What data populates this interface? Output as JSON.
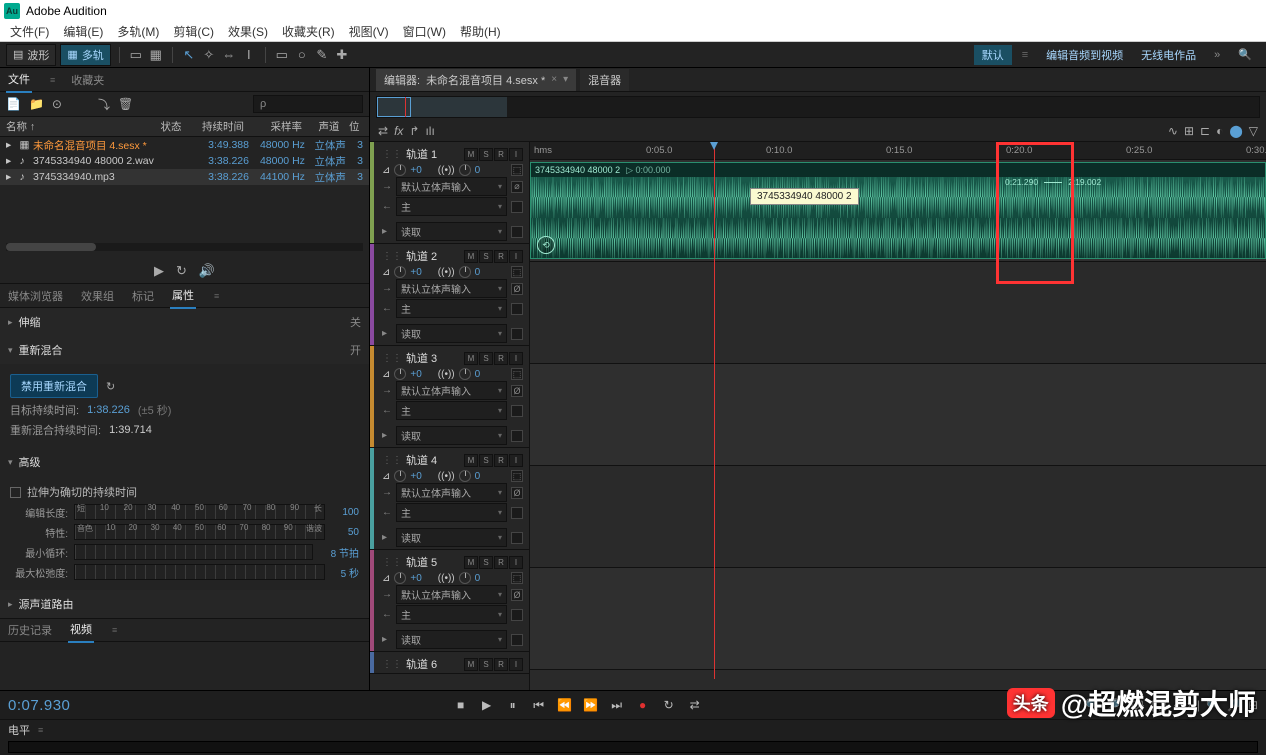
{
  "app": {
    "title": "Adobe Audition"
  },
  "menubar": [
    "文件(F)",
    "编辑(E)",
    "多轨(M)",
    "剪辑(C)",
    "效果(S)",
    "收藏夹(R)",
    "视图(V)",
    "窗口(W)",
    "帮助(H)"
  ],
  "toolbar": {
    "waveform": "波形",
    "multitrack": "多轨"
  },
  "workspaces": [
    "默认",
    "编辑音频到视频",
    "无线电作品"
  ],
  "files_panel": {
    "tabs": [
      "文件",
      "收藏夹"
    ],
    "search_placeholder": "ρ",
    "columns": {
      "name": "名称 ↑",
      "status": "状态",
      "duration": "持续时间",
      "rate": "采样率",
      "channels": "声道",
      "depth": "位"
    },
    "rows": [
      {
        "icon": "▸",
        "type": "sesx",
        "name": "未命名混音项目 4.sesx *",
        "dur": "3:49.388",
        "rate": "48000 Hz",
        "ch": "立体声",
        "d": "3"
      },
      {
        "icon": "▸",
        "type": "wav",
        "name": "3745334940 48000 2.wav",
        "dur": "3:38.226",
        "rate": "48000 Hz",
        "ch": "立体声",
        "d": "3"
      },
      {
        "icon": "▸",
        "type": "mp3",
        "name": "3745334940.mp3",
        "dur": "3:38.226",
        "rate": "44100 Hz",
        "ch": "立体声",
        "d": "3"
      }
    ],
    "transport_icons": [
      "▶",
      "↻",
      "🔊"
    ]
  },
  "props_panel": {
    "tabs": [
      "媒体浏览器",
      "效果组",
      "标记",
      "属性"
    ],
    "section_stretch": "伸缩",
    "close": "关",
    "open": "开",
    "remix_header": "重新混合",
    "disable_remix": "禁用重新混合",
    "target_label": "目标持续时间:",
    "target_value": "1:38.226",
    "target_hint": "(±5 秒)",
    "remix_dur_label": "重新混合持续时间:",
    "remix_dur_value": "1:39.714",
    "advanced": "高级",
    "stretch_exact": "拉伸为确切的持续时间",
    "edit_len": "编辑长度:",
    "edit_ruler": [
      "短",
      "10",
      "20",
      "30",
      "40",
      "50",
      "60",
      "70",
      "80",
      "90",
      "长"
    ],
    "edit_val": "100",
    "feature": "特性:",
    "feature_ruler": [
      "音色",
      "10",
      "20",
      "30",
      "40",
      "50",
      "60",
      "70",
      "80",
      "90",
      "谐波"
    ],
    "feature_val": "50",
    "min_loop": "最小循环:",
    "min_loop_val": "8 节拍",
    "max_slack": "最大松弛度:",
    "max_slack_val": "5 秒",
    "src_routing": "源声道路由",
    "history": "历史记录",
    "video": "视频"
  },
  "editor": {
    "tab_prefix": "编辑器:",
    "session": "未命名混音项目 4.sesx *",
    "mixer": "混音器",
    "ruler_unit": "hms",
    "ticks": [
      "0:05.0",
      "0:10.0",
      "0:15.0",
      "0:20.0",
      "0:25.0",
      "0:30.0"
    ],
    "tracks": [
      {
        "c": "#7fa050",
        "name": "轨道 1"
      },
      {
        "c": "#8a4aa0",
        "name": "轨道 2"
      },
      {
        "c": "#c58a30",
        "name": "轨道 3"
      },
      {
        "c": "#4aa0a0",
        "name": "轨道 4"
      },
      {
        "c": "#a04a7a",
        "name": "轨道 5"
      },
      {
        "c": "#4a6aa0",
        "name": "轨道 6"
      }
    ],
    "msr": [
      "M",
      "S",
      "R",
      "I"
    ],
    "vol": "+0",
    "pan": "0",
    "input": "默认立体声输入",
    "output": "主",
    "read": "读取",
    "knob_icons": [
      "⊿",
      "⤫"
    ],
    "clip": {
      "name": "3745334940 48000 2",
      "start": "0:00.000",
      "tooltip": "3745334940 48000 2",
      "marker_left": "0:21.290",
      "marker_right": "2:19.002"
    }
  },
  "bottom": {
    "timecode": "0:07.930",
    "transport": [
      "■",
      "▶",
      "⏸",
      "⏮",
      "⏪",
      "⏩",
      "⏭",
      "●",
      "↻",
      "⇄"
    ],
    "zoom": [
      "🔍",
      "🔎",
      "{Q}",
      "{Q}",
      "‹Q›",
      "|",
      "🔍",
      "🔎",
      "⊞"
    ],
    "levels": "电平"
  },
  "watermark": {
    "badge": "头条",
    "text": "@超燃混剪大师"
  }
}
